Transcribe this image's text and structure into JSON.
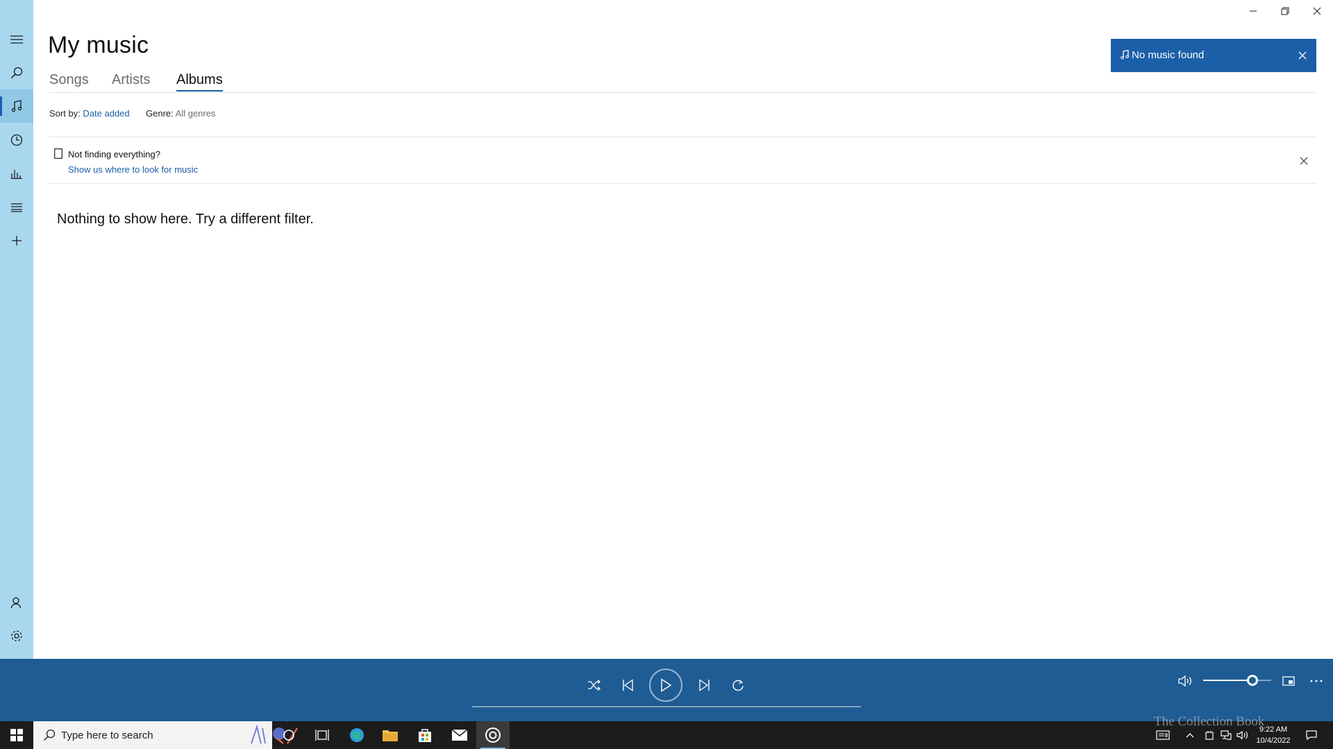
{
  "app": {
    "title": "My music",
    "tabs": [
      {
        "label": "Songs",
        "active": false
      },
      {
        "label": "Artists",
        "active": false
      },
      {
        "label": "Albums",
        "active": true
      }
    ]
  },
  "filters": {
    "sort_label": "Sort by:",
    "sort_value": "Date added",
    "genre_label": "Genre:",
    "genre_value": "All genres"
  },
  "banner": {
    "title": "Not finding everything?",
    "link": "Show us where to look for music"
  },
  "empty_message": "Nothing to show here. Try a different filter.",
  "toast": {
    "text": "No music found"
  },
  "nav": {
    "items": [
      "menu-icon",
      "search-icon",
      "music-note-icon",
      "clock-icon",
      "bar-chart-icon",
      "playlist-icon",
      "plus-icon"
    ],
    "bottom_items": [
      "account-icon",
      "gear-icon"
    ],
    "active_item": "music-note-icon"
  },
  "player": {
    "controls": [
      "shuffle-icon",
      "previous-icon",
      "play-icon",
      "next-icon",
      "repeat-icon"
    ],
    "volume_fraction": 0.72,
    "progress_fraction": 0
  },
  "taskbar": {
    "search_placeholder": "Type here to search",
    "time": "9:22 AM",
    "date": "10/4/2022"
  },
  "watermark": "The Collection Book",
  "colors": {
    "accent": "#1b5fa8",
    "rail": "#a9d8ee",
    "player": "#1f5c93",
    "taskbar": "#1c1c1c"
  }
}
